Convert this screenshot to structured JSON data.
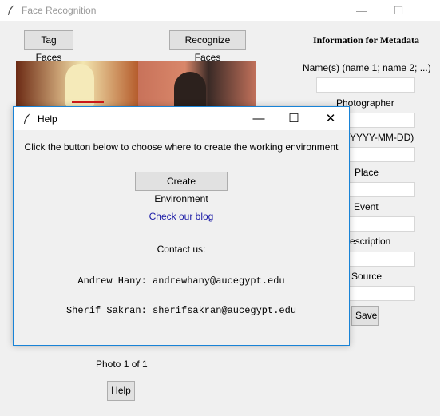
{
  "window": {
    "title": "Face Recognition",
    "minimize": "—",
    "maximize": "☐",
    "close": "✕"
  },
  "toolbar": {
    "tag_faces": "Tag Faces",
    "recognize_faces": "Recognize Faces"
  },
  "metadata": {
    "heading": "Information for Metadata",
    "names_label": "Name(s)  (name 1; name 2; ...)",
    "photographer_label": "Photographer",
    "date_label": "YYYY-MM-DD)",
    "place_label": "Place",
    "event_label": "Event",
    "description_label": "escription",
    "source_label": "Source",
    "save": "Save"
  },
  "footer": {
    "photo_counter": "Photo 1 of 1",
    "help": "Help"
  },
  "help_dialog": {
    "title": "Help",
    "minimize": "—",
    "maximize": "☐",
    "close": "✕",
    "instruction": "Click the button below to choose where to create the working environment",
    "create_env": "Create Environment",
    "blog_link": "Check our blog",
    "contact_heading": "Contact us:",
    "contact_1": "Andrew Hany: andrewhany@aucegypt.edu",
    "contact_2": "Sherif Sakran: sherifsakran@aucegypt.edu"
  },
  "colors": {
    "dialog_border": "#1883d7",
    "link": "#1a1aa6"
  }
}
